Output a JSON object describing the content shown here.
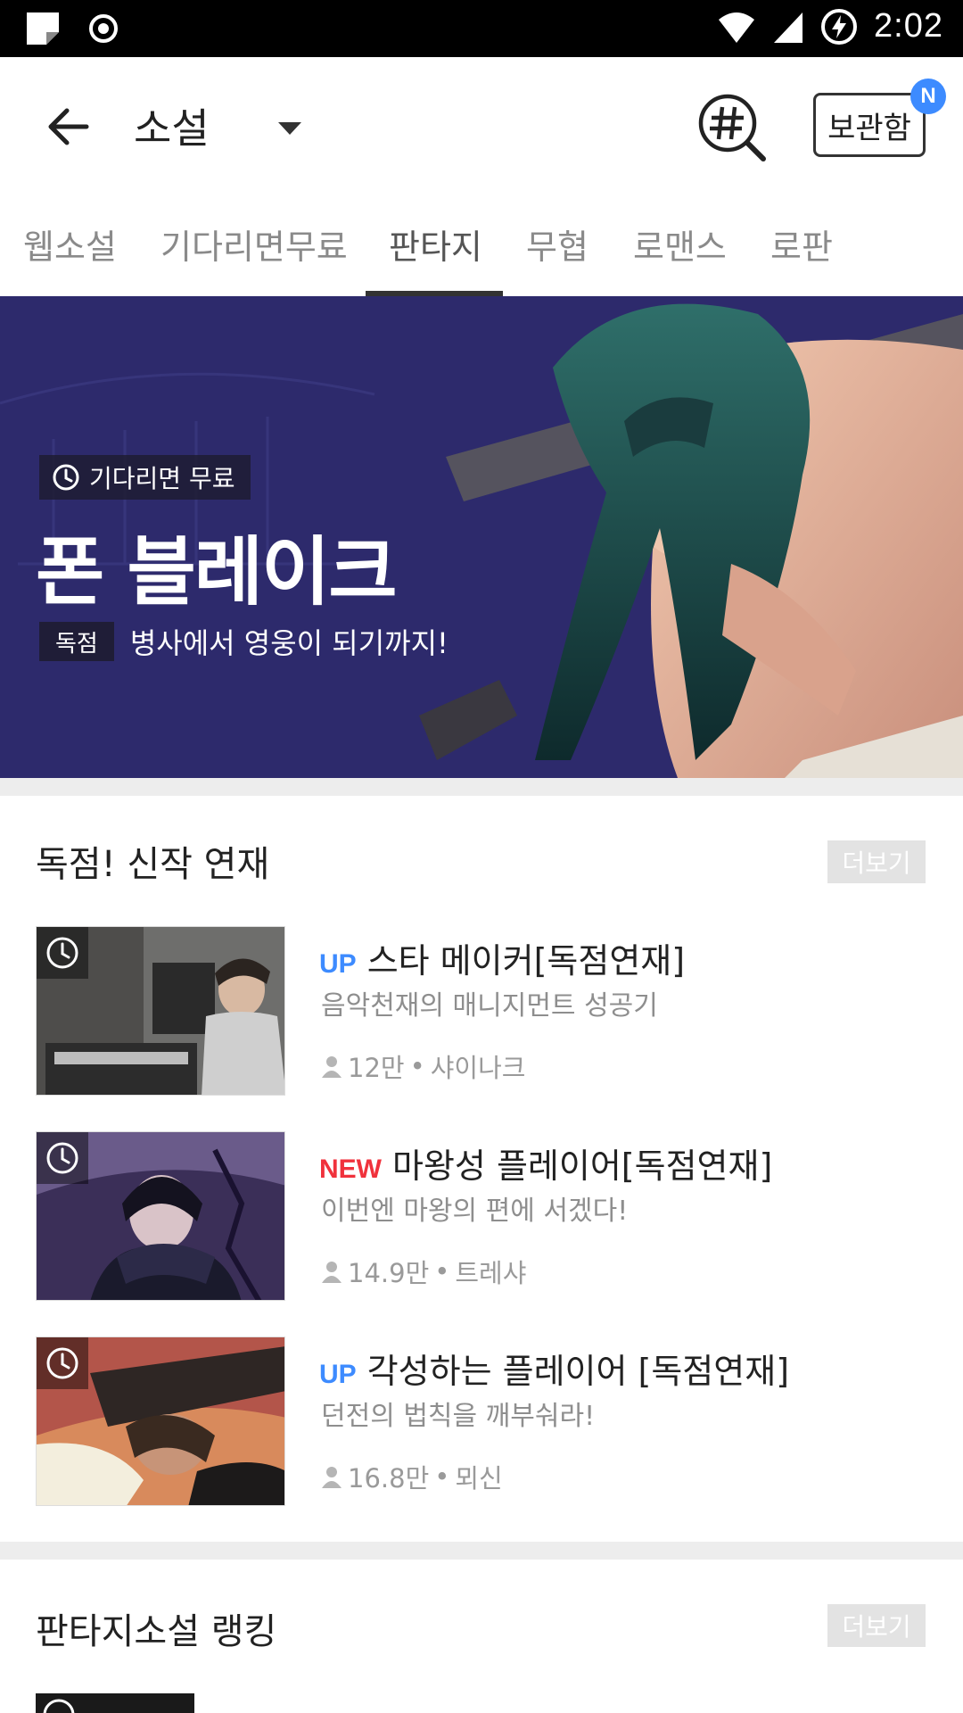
{
  "status_bar": {
    "time": "2:02",
    "icons": [
      "sticky-note-icon",
      "record-icon",
      "wifi-icon",
      "signal-icon",
      "battery-charging-icon"
    ]
  },
  "app_bar": {
    "title": "소설",
    "locker_label": "보관함",
    "badge": "N"
  },
  "tabs": [
    {
      "label": "웹소설",
      "active": false
    },
    {
      "label": "기다리면무료",
      "active": false
    },
    {
      "label": "판타지",
      "active": true
    },
    {
      "label": "무협",
      "active": false
    },
    {
      "label": "로맨스",
      "active": false
    },
    {
      "label": "로판",
      "active": false
    }
  ],
  "banner": {
    "badge": "기다리면 무료",
    "title": "폰 블레이크",
    "tag": "독점",
    "subtitle": "병사에서 영웅이 되기까지!"
  },
  "section_new": {
    "title": "독점! 신작 연재",
    "more": "더보기",
    "items": [
      {
        "flag": "UP",
        "flag_color": "#3d8bff",
        "title": "스타 메이커[독점연재]",
        "desc": "음악천재의 매니지먼트 성공기",
        "views": "12만",
        "author": "샤이나크"
      },
      {
        "flag": "NEW",
        "flag_color": "#f0323c",
        "title": "마왕성 플레이어[독점연재]",
        "desc": "이번엔 마왕의 편에 서겠다!",
        "views": "14.9만",
        "author": "트레샤"
      },
      {
        "flag": "UP",
        "flag_color": "#3d8bff",
        "title": "각성하는 플레이어 [독점연재]",
        "desc": "던전의 법칙을 깨부숴라!",
        "views": "16.8만",
        "author": "뫼신"
      }
    ]
  },
  "section_ranking": {
    "title": "판타지소설 랭킹",
    "more": "더보기"
  },
  "meta_separator": "•"
}
